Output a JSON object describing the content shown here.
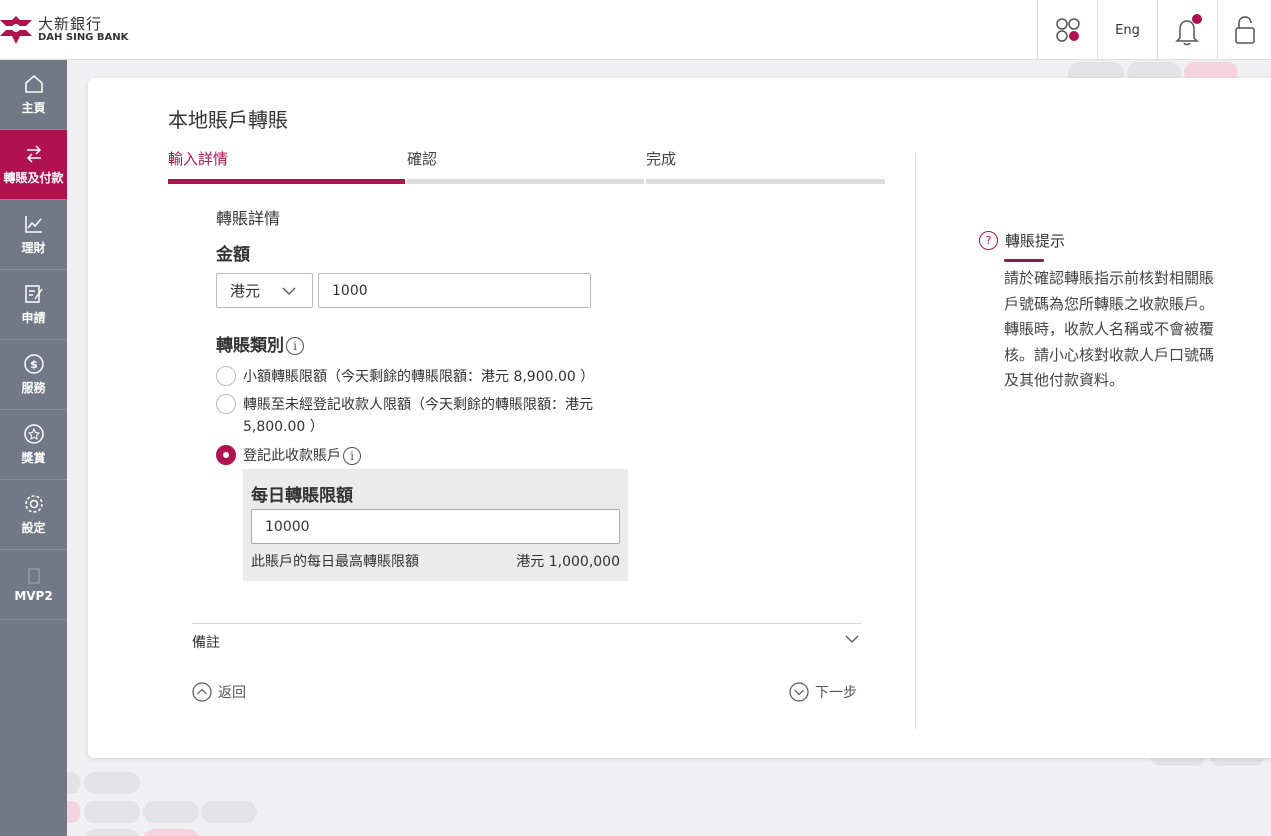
{
  "brand": {
    "name_cn": "大新銀行",
    "name_en": "DAH SING BANK",
    "accent": "#b0124f"
  },
  "header": {
    "apps_icon": "apps-icon",
    "lang_label": "Eng",
    "bell_icon": "bell-icon",
    "lock_icon": "lock-icon"
  },
  "sidebar": {
    "items": [
      {
        "label": "主頁",
        "icon": "home-icon",
        "active": false
      },
      {
        "label": "轉賬及付款",
        "icon": "transfer-icon",
        "active": true
      },
      {
        "label": "理財",
        "icon": "chart-icon",
        "active": false
      },
      {
        "label": "申請",
        "icon": "application-icon",
        "active": false
      },
      {
        "label": "服務",
        "icon": "dollar-icon",
        "active": false
      },
      {
        "label": "獎賞",
        "icon": "reward-icon",
        "active": false
      },
      {
        "label": "設定",
        "icon": "gear-icon",
        "active": false
      },
      {
        "label": "MVP2",
        "icon": "document-icon",
        "active": false
      }
    ]
  },
  "page": {
    "title": "本地賬戶轉賬"
  },
  "steps": [
    {
      "label": "輸入詳情",
      "active": true
    },
    {
      "label": "確認",
      "active": false
    },
    {
      "label": "完成",
      "active": false
    }
  ],
  "form": {
    "section_title": "轉賬詳情",
    "amount_label": "金額",
    "currency": "港元",
    "amount_value": "1000",
    "transfer_type_label": "轉賬類別",
    "info_glyph": "i",
    "options": [
      {
        "text": "小額轉賬限額（今天剩餘的轉賬限額：港元 8,900.00 ）",
        "checked": false
      },
      {
        "text": "轉賬至未經登記收款人限額（今天剩餘的轉賬限額：港元 5,800.00 ）",
        "checked": false
      },
      {
        "text": "登記此收款賬戶",
        "checked": true
      }
    ],
    "daily_limit": {
      "title": "每日轉賬限額",
      "value": "10000",
      "note": "此賬戶的每日最高轉賬限額",
      "max": "港元 1,000,000"
    },
    "remarks_label": "備註",
    "back_label": "返回",
    "next_label": "下一步"
  },
  "tips": {
    "question_glyph": "?",
    "title": "轉賬提示",
    "body": "請於確認轉賬指示前核對相關賬戶號碼為您所轉賬之收款賬戶。轉賬時，收款人名稱或不會被覆核。請小心核對收款人戶口號碼及其他付款資料。"
  }
}
